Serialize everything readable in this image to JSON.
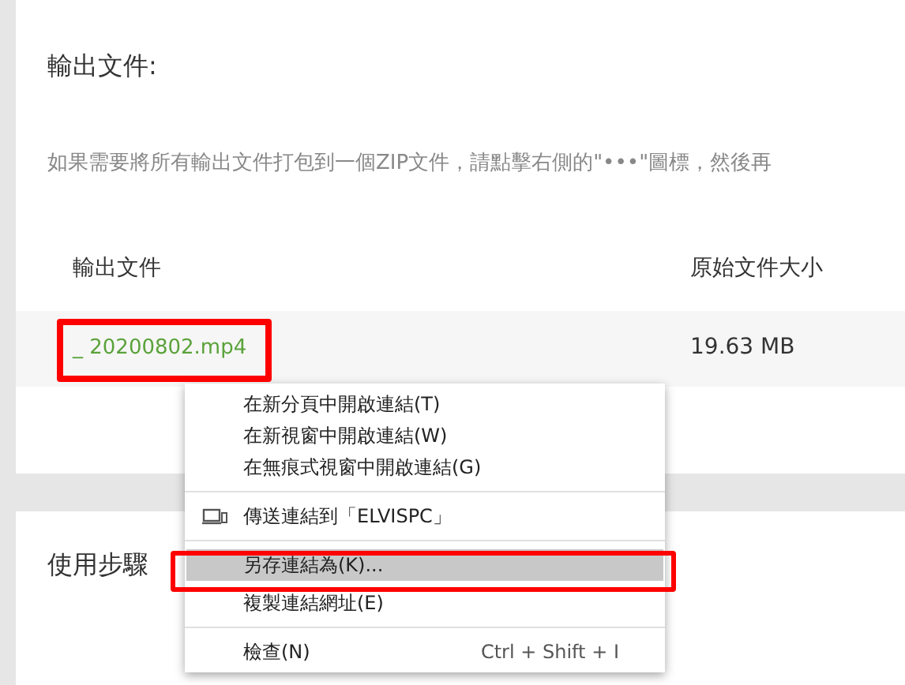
{
  "output_section": {
    "title": "輸出文件:",
    "description": "如果需要將所有輸出文件打包到一個ZIP文件，請點擊右側的\"•••\"圖標，然後再"
  },
  "table": {
    "columns": [
      "輸出文件",
      "原始文件大小"
    ],
    "rows": [
      {
        "file": "_ 20200802.mp4",
        "size": "19.63 MB"
      }
    ]
  },
  "steps_section": {
    "title": "使用步驟"
  },
  "context_menu": {
    "items": [
      {
        "kind": "item",
        "label": "在新分頁中開啟連結(T)",
        "selected": false
      },
      {
        "kind": "item",
        "label": "在新視窗中開啟連結(W)",
        "selected": false
      },
      {
        "kind": "item",
        "label": "在無痕式視窗中開啟連結(G)",
        "selected": false
      },
      {
        "kind": "separator"
      },
      {
        "kind": "device",
        "label": "傳送連結到「ELVISPC」",
        "selected": false
      },
      {
        "kind": "separator"
      },
      {
        "kind": "item",
        "label": "另存連結為(K)...",
        "selected": true
      },
      {
        "kind": "item",
        "label": "複製連結網址(E)",
        "selected": false
      },
      {
        "kind": "separator"
      },
      {
        "kind": "item",
        "label": "檢查(N)",
        "shortcut": "Ctrl + Shift + I",
        "selected": false
      }
    ]
  }
}
